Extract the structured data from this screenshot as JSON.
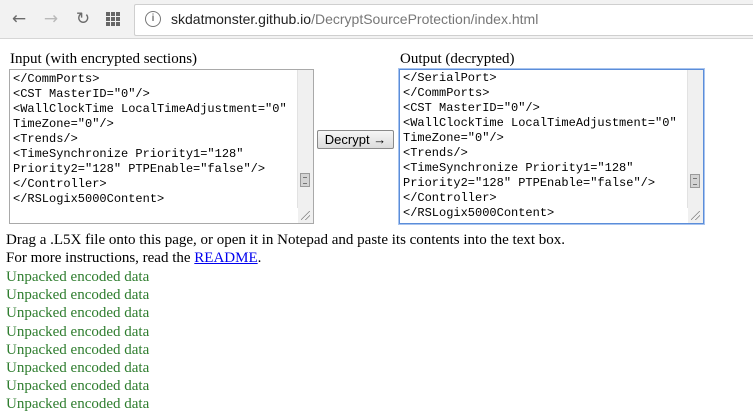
{
  "browser": {
    "back_icon": "←",
    "forward_icon": "→",
    "reload_icon": "↻",
    "info_icon": "i",
    "url_host": "skdatmonster.github.io",
    "url_path": "/DecryptSourceProtection/index.html"
  },
  "input": {
    "label": "Input (with encrypted sections)",
    "text": "</CommPorts>\n<CST MasterID=\"0\"/>\n<WallClockTime LocalTimeAdjustment=\"0\"\nTimeZone=\"0\"/>\n<Trends/>\n<TimeSynchronize Priority1=\"128\"\nPriority2=\"128\" PTPEnable=\"false\"/>\n</Controller>\n</RSLogix5000Content>"
  },
  "decrypt_button": {
    "label": "Decrypt →"
  },
  "output": {
    "label": "Output (decrypted)",
    "text": "</SerialPort>\n</CommPorts>\n<CST MasterID=\"0\"/>\n<WallClockTime LocalTimeAdjustment=\"0\"\nTimeZone=\"0\"/>\n<Trends/>\n<TimeSynchronize Priority1=\"128\"\nPriority2=\"128\" PTPEnable=\"false\"/>\n</Controller>\n</RSLogix5000Content>"
  },
  "instructions": {
    "line1": "Drag a .L5X file onto this page, or open it in Notepad and paste its contents into the text box.",
    "line2_prefix": "For more instructions, read the ",
    "readme_link": "README",
    "line2_suffix": "."
  },
  "messages": [
    "Unpacked encoded data",
    "Unpacked encoded data",
    "Unpacked encoded data",
    "Unpacked encoded data",
    "Unpacked encoded data",
    "Unpacked encoded data",
    "Unpacked encoded data",
    "Unpacked encoded data"
  ],
  "colors": {
    "message_green": "#2e7d2e",
    "link_blue": "#0000ee",
    "focus_blue": "#5b8dd9"
  }
}
